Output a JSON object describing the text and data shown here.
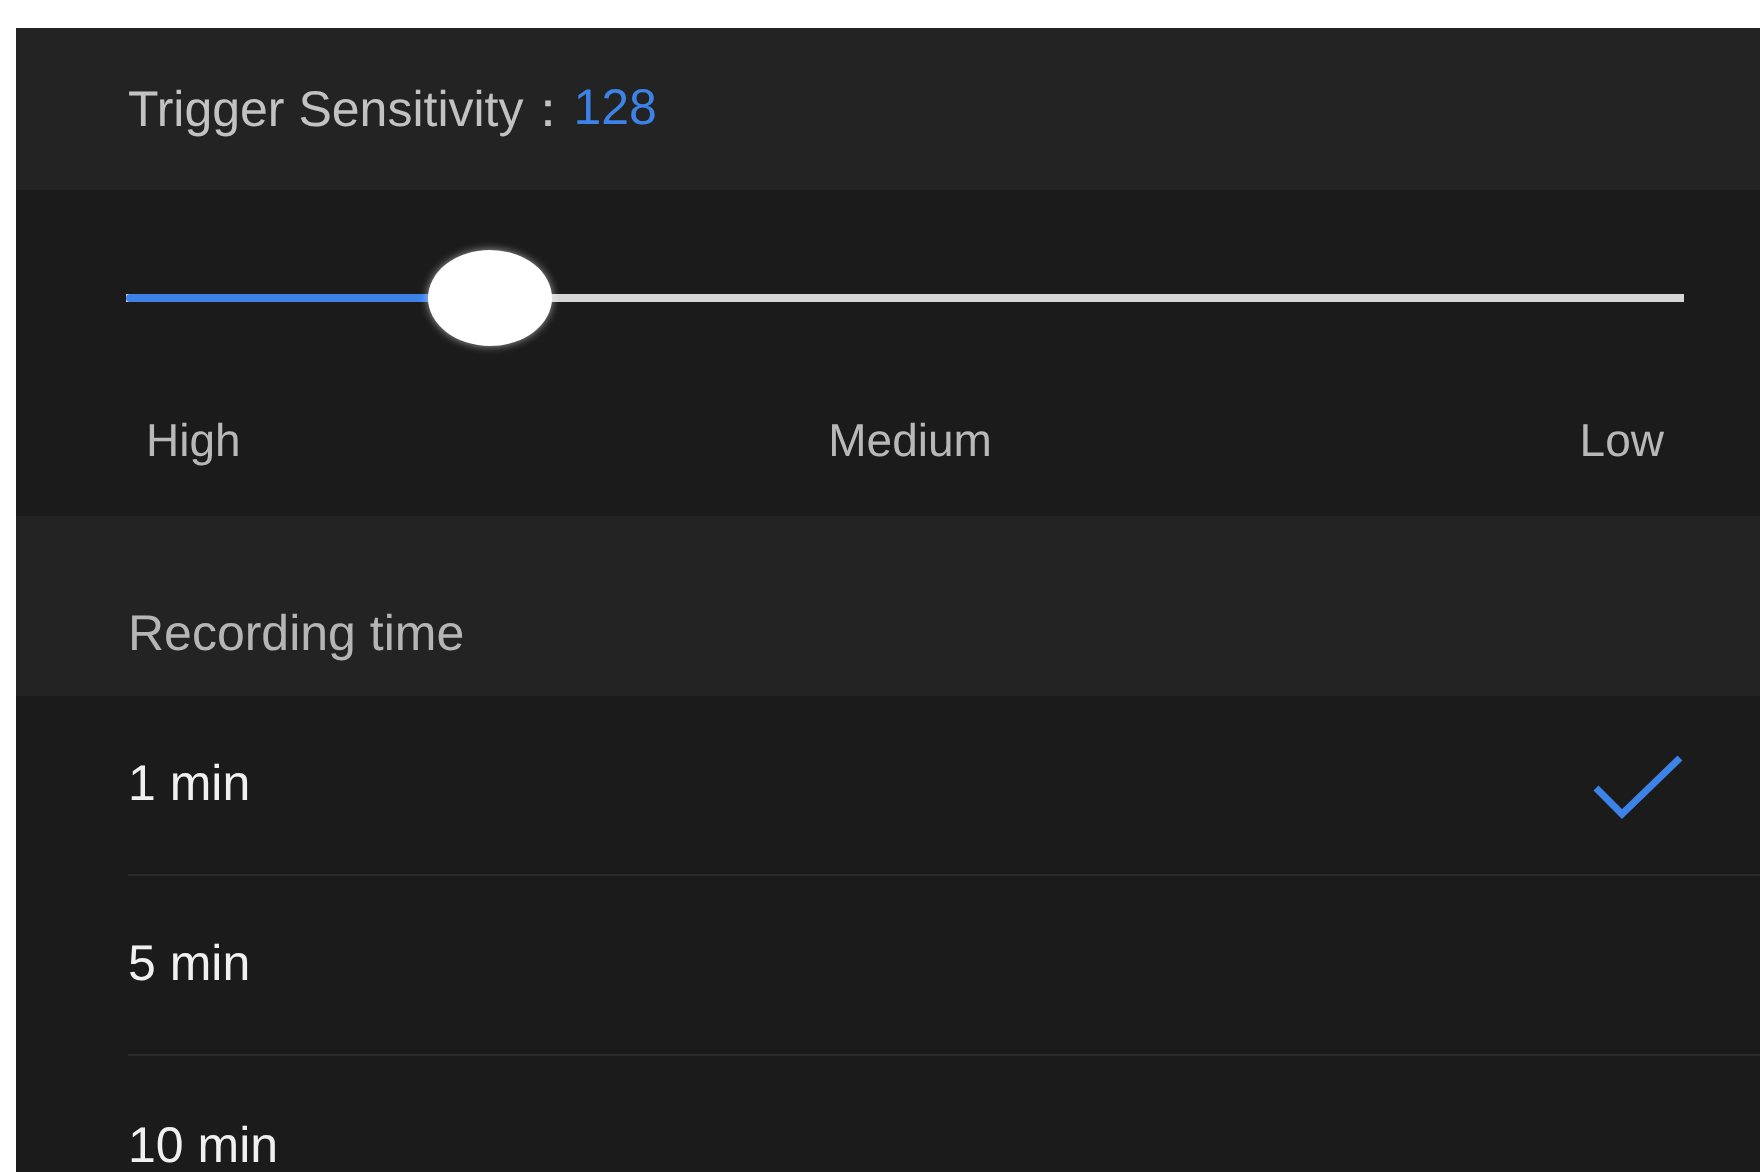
{
  "sensitivity": {
    "label": "Trigger Sensitivity：",
    "value": "128",
    "level": 0.234,
    "scale": [
      "High",
      "Medium",
      "Low"
    ]
  },
  "recording": {
    "title": "Recording time",
    "options": [
      {
        "label": "1 min",
        "selected": true
      },
      {
        "label": "5 min",
        "selected": false
      },
      {
        "label": "10 min",
        "selected": false
      }
    ]
  }
}
